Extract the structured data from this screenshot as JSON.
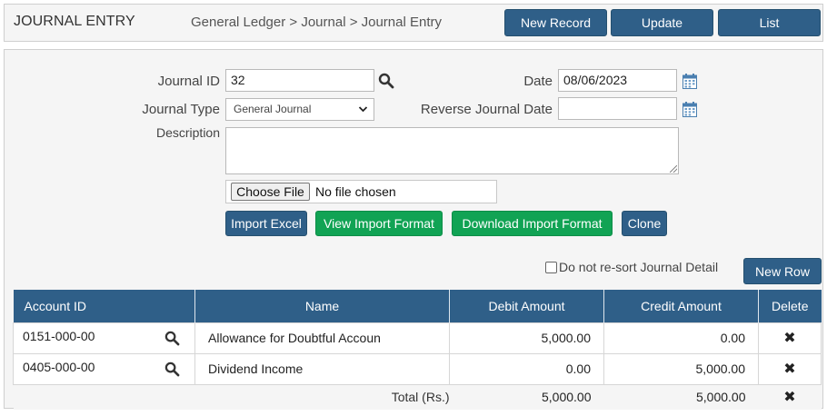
{
  "header": {
    "title": "JOURNAL ENTRY",
    "breadcrumb": "General Ledger > Journal > Journal Entry",
    "buttons": {
      "new_record": "New Record",
      "update": "Update",
      "list": "List"
    }
  },
  "form": {
    "journal_id": {
      "label": "Journal ID",
      "value": "32"
    },
    "date": {
      "label": "Date",
      "value": "08/06/2023"
    },
    "journal_type": {
      "label": "Journal Type",
      "value": "General Journal"
    },
    "reverse_journal_date": {
      "label": "Reverse Journal Date",
      "value": ""
    },
    "description": {
      "label": "Description",
      "value": ""
    },
    "file": {
      "choose_label": "Choose File",
      "status": "No file chosen"
    }
  },
  "actions": {
    "import_excel": "Import Excel",
    "view_import_format": "View Import Format",
    "download_import_format": "Download Import Format",
    "clone": "Clone",
    "new_row": "New Row"
  },
  "options": {
    "no_resort_label": "Do not re-sort Journal Detail",
    "no_resort_checked": false
  },
  "table": {
    "headers": {
      "account_id": "Account ID",
      "name": "Name",
      "debit": "Debit Amount",
      "credit": "Credit Amount",
      "delete": "Delete"
    },
    "rows": [
      {
        "account_id": "0151-000-00",
        "name": "Allowance for Doubtful Accoun",
        "debit": "5,000.00",
        "credit": "0.00"
      },
      {
        "account_id": "0405-000-00",
        "name": "Dividend Income",
        "debit": "0.00",
        "credit": "5,000.00"
      }
    ],
    "total": {
      "label": "Total (Rs.)",
      "debit": "5,000.00",
      "credit": "5,000.00"
    }
  },
  "icons": {
    "delete": "✖",
    "search": "search-icon",
    "calendar": "calendar-icon"
  },
  "colors": {
    "primary": "#2f5f88",
    "success": "#11a354",
    "danger": "#e0282e",
    "total_text": "#1f8b3a"
  }
}
